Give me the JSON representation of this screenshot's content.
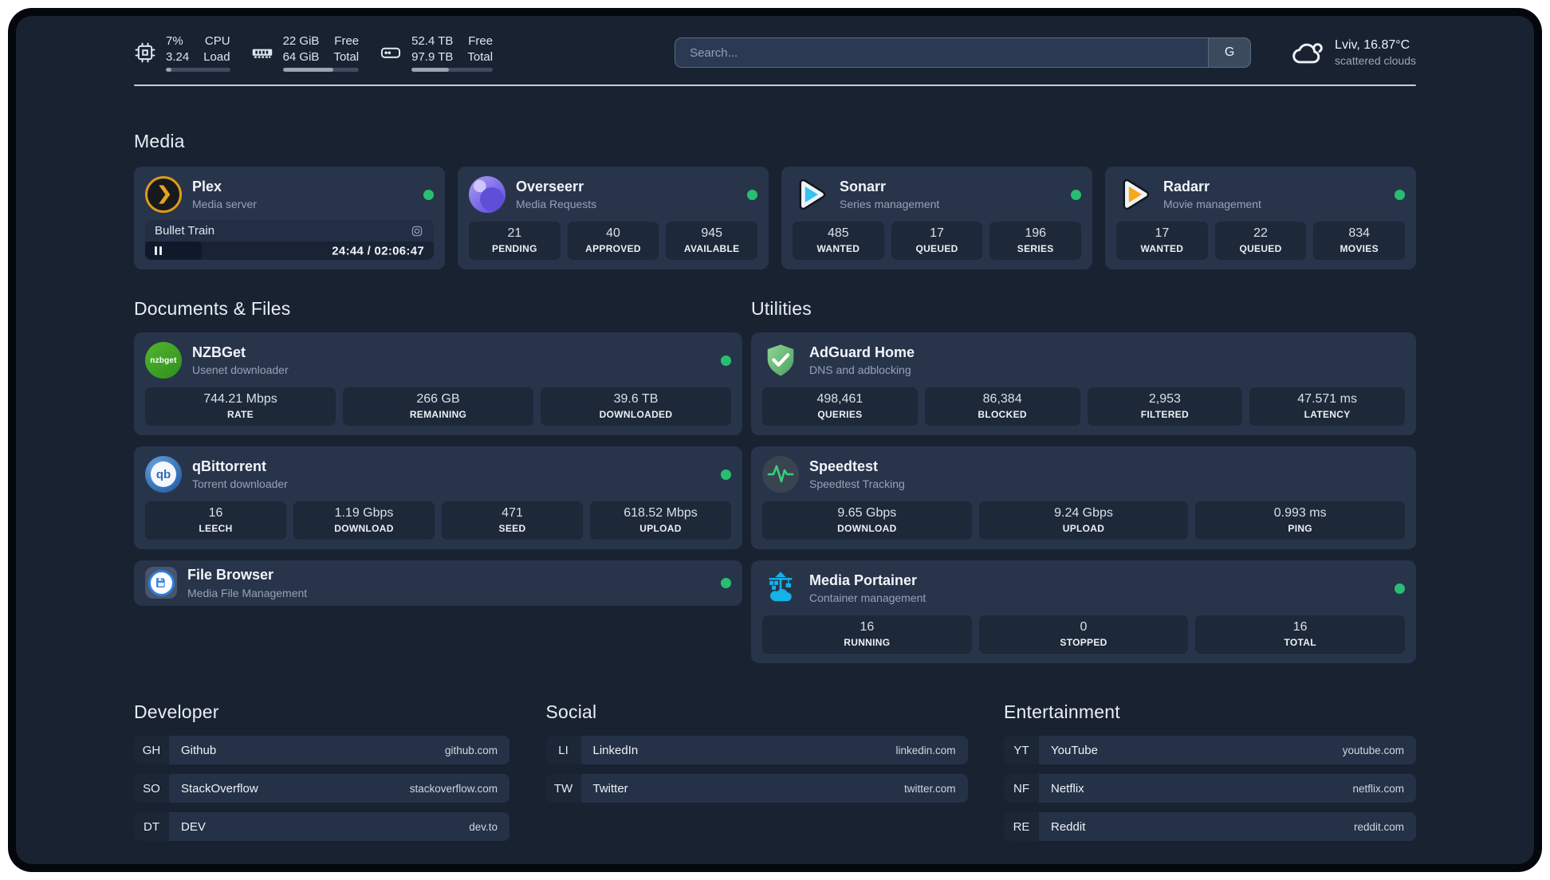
{
  "colors": {
    "status_green": "#28be72",
    "page_bg": "#192231",
    "card_bg": "#28344a",
    "divider": "#d8dde4"
  },
  "header": {
    "stats": [
      {
        "icon": "cpu-icon",
        "values": [
          "7%",
          "3.24"
        ],
        "labels": [
          "CPU",
          "Load"
        ],
        "progress_pct": 9
      },
      {
        "icon": "ram-icon",
        "values": [
          "22 GiB",
          "64 GiB"
        ],
        "labels": [
          "Free",
          "Total"
        ],
        "progress_pct": 66
      },
      {
        "icon": "disk-icon",
        "values": [
          "52.4 TB",
          "97.9 TB"
        ],
        "labels": [
          "Free",
          "Total"
        ],
        "progress_pct": 46
      }
    ],
    "search": {
      "placeholder": "Search...",
      "provider_label": "G"
    },
    "weather": {
      "summary": "Lviv, 16.87°C",
      "condition": "scattered clouds"
    }
  },
  "media": {
    "title": "Media",
    "plex": {
      "name": "Plex",
      "desc": "Media server",
      "player": {
        "title": "Bullet Train",
        "time": "24:44 / 02:06:47",
        "progress_pct": 19.6
      }
    },
    "overseerr": {
      "name": "Overseerr",
      "desc": "Media Requests",
      "stats": [
        {
          "value": "21",
          "label": "PENDING"
        },
        {
          "value": "40",
          "label": "APPROVED"
        },
        {
          "value": "945",
          "label": "AVAILABLE"
        }
      ]
    },
    "sonarr": {
      "name": "Sonarr",
      "desc": "Series management",
      "stats": [
        {
          "value": "485",
          "label": "WANTED"
        },
        {
          "value": "17",
          "label": "QUEUED"
        },
        {
          "value": "196",
          "label": "SERIES"
        }
      ]
    },
    "radarr": {
      "name": "Radarr",
      "desc": "Movie management",
      "stats": [
        {
          "value": "17",
          "label": "WANTED"
        },
        {
          "value": "22",
          "label": "QUEUED"
        },
        {
          "value": "834",
          "label": "MOVIES"
        }
      ]
    }
  },
  "documents": {
    "title": "Documents & Files",
    "nzbget": {
      "name": "NZBGet",
      "desc": "Usenet downloader",
      "icon_text": "nzbget",
      "stats": [
        {
          "value": "744.21 Mbps",
          "label": "RATE"
        },
        {
          "value": "266 GB",
          "label": "REMAINING"
        },
        {
          "value": "39.6 TB",
          "label": "DOWNLOADED"
        }
      ]
    },
    "qbittorrent": {
      "name": "qBittorrent",
      "desc": "Torrent downloader",
      "icon_text": "qb",
      "stats": [
        {
          "value": "16",
          "label": "LEECH"
        },
        {
          "value": "1.19 Gbps",
          "label": "DOWNLOAD"
        },
        {
          "value": "471",
          "label": "SEED"
        },
        {
          "value": "618.52 Mbps",
          "label": "UPLOAD"
        }
      ]
    },
    "filebrowser": {
      "name": "File Browser",
      "desc": "Media File Management"
    }
  },
  "utilities": {
    "title": "Utilities",
    "adguard": {
      "name": "AdGuard Home",
      "desc": "DNS and adblocking",
      "stats": [
        {
          "value": "498,461",
          "label": "QUERIES"
        },
        {
          "value": "86,384",
          "label": "BLOCKED"
        },
        {
          "value": "2,953",
          "label": "FILTERED"
        },
        {
          "value": "47.571 ms",
          "label": "LATENCY"
        }
      ]
    },
    "speedtest": {
      "name": "Speedtest",
      "desc": "Speedtest Tracking",
      "stats": [
        {
          "value": "9.65 Gbps",
          "label": "DOWNLOAD"
        },
        {
          "value": "9.24 Gbps",
          "label": "UPLOAD"
        },
        {
          "value": "0.993 ms",
          "label": "PING"
        }
      ]
    },
    "portainer": {
      "name": "Media Portainer",
      "desc": "Container management",
      "stats": [
        {
          "value": "16",
          "label": "RUNNING"
        },
        {
          "value": "0",
          "label": "STOPPED"
        },
        {
          "value": "16",
          "label": "TOTAL"
        }
      ]
    }
  },
  "bookmarks": {
    "developer": {
      "title": "Developer",
      "links": [
        {
          "abbr": "GH",
          "name": "Github",
          "domain": "github.com"
        },
        {
          "abbr": "SO",
          "name": "StackOverflow",
          "domain": "stackoverflow.com"
        },
        {
          "abbr": "DT",
          "name": "DEV",
          "domain": "dev.to"
        }
      ]
    },
    "social": {
      "title": "Social",
      "links": [
        {
          "abbr": "LI",
          "name": "LinkedIn",
          "domain": "linkedin.com"
        },
        {
          "abbr": "TW",
          "name": "Twitter",
          "domain": "twitter.com"
        }
      ]
    },
    "entertainment": {
      "title": "Entertainment",
      "links": [
        {
          "abbr": "YT",
          "name": "YouTube",
          "domain": "youtube.com"
        },
        {
          "abbr": "NF",
          "name": "Netflix",
          "domain": "netflix.com"
        },
        {
          "abbr": "RE",
          "name": "Reddit",
          "domain": "reddit.com"
        }
      ]
    }
  }
}
